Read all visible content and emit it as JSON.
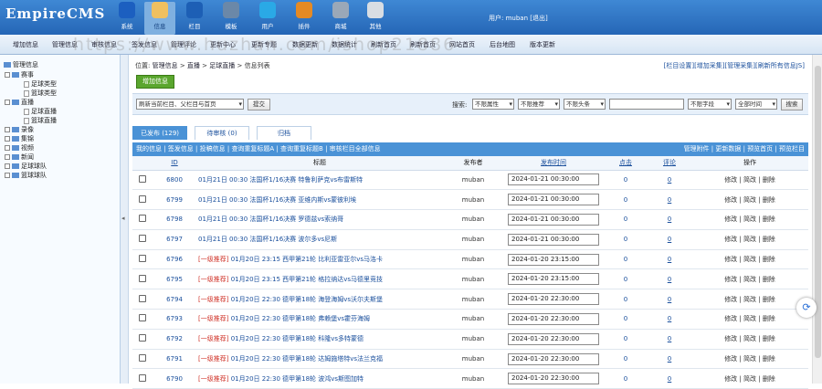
{
  "header": {
    "logo": "EmpireCMS",
    "user_label": "用户:",
    "user_name": "muban",
    "logout": "[退出]"
  },
  "nav": [
    {
      "label": "系统",
      "icon": "globe-icon",
      "color": "#1c5fc0"
    },
    {
      "label": "信息",
      "icon": "document-edit-icon",
      "color": "#f0c060"
    },
    {
      "label": "栏目",
      "icon": "folder-icon",
      "color": "#1d5fb5"
    },
    {
      "label": "模板",
      "icon": "template-icon",
      "color": "#6b88a8"
    },
    {
      "label": "用户",
      "icon": "user-icon",
      "color": "#2aa9e6"
    },
    {
      "label": "插件",
      "icon": "plugin-icon",
      "color": "#e48a25"
    },
    {
      "label": "商城",
      "icon": "shop-icon",
      "color": "#9aa8b8"
    },
    {
      "label": "其他",
      "icon": "gear-icon",
      "color": "#d8dde3"
    }
  ],
  "menu": [
    "增加信息",
    "管理信息",
    "审核信息",
    "签发信息",
    "管理评论",
    "更新中心",
    "更新专题",
    "数据更新",
    "数据统计",
    "刷新首页",
    "刷新首页",
    "网站首页",
    "后台地图",
    "版本更新"
  ],
  "watermark": "https://www.huzhan.com/ishop21886",
  "tree": {
    "title": "管理信息",
    "items": [
      {
        "label": "赛事",
        "level": 0
      },
      {
        "label": "足球类型",
        "level": 1
      },
      {
        "label": "篮球类型",
        "level": 1
      },
      {
        "label": "直播",
        "level": 0
      },
      {
        "label": "足球直播",
        "level": 1
      },
      {
        "label": "篮球直播",
        "level": 1
      },
      {
        "label": "录像",
        "level": 0
      },
      {
        "label": "集锦",
        "level": 0
      },
      {
        "label": "视频",
        "level": 0
      },
      {
        "label": "新闻",
        "level": 0
      },
      {
        "label": "足球球队",
        "level": 0
      },
      {
        "label": "篮球球队",
        "level": 0
      }
    ]
  },
  "location": {
    "prefix": "位置:",
    "crumbs": [
      "管理信息",
      "直播",
      "足球直播"
    ],
    "current": "信息列表"
  },
  "toplinks": [
    "[栏目设置]",
    "[增加采集]",
    "[管理采集]",
    "[刷新所有信息JS]"
  ],
  "add_button": "增加信息",
  "toolbar": {
    "refresh_select": "刷新当前栏目、父栏目与首页",
    "submit": "提交",
    "search_label": "搜索:",
    "attr_select": "不限属性",
    "recommend_select": "不限推荐",
    "headline_select": "不限头条",
    "field_select": "不限字段",
    "time_select": "全部时间",
    "search_button": "搜索"
  },
  "tabs": [
    {
      "label": "已发布 (129)",
      "active": true
    },
    {
      "label": "待审核 (0)",
      "active": false
    },
    {
      "label": "归档",
      "active": false
    }
  ],
  "subbar": {
    "left": [
      "我的信息",
      "签发信息",
      "投稿信息",
      "查询重复标题A",
      "查询重复标题B",
      "审核栏目全部信息"
    ],
    "right": [
      "管理附件",
      "更新数据",
      "预览首页",
      "预览栏目"
    ]
  },
  "columns": [
    "ID",
    "标题",
    "发布者",
    "发布时间",
    "点击",
    "评论",
    "操作"
  ],
  "rows": [
    {
      "id": "6800",
      "rec": "",
      "title": "01月21日 00:30 法国杯1/16决赛 特鲁利萨克vs布雷斯特",
      "author": "muban",
      "time": "2024-01-21 00:30:00",
      "clicks": "0",
      "comments": "0"
    },
    {
      "id": "6799",
      "rec": "",
      "title": "01月21日 00:30 法国杯1/16决赛 亚维内斯vs蒙彼利埃",
      "author": "muban",
      "time": "2024-01-21 00:30:00",
      "clicks": "0",
      "comments": "0"
    },
    {
      "id": "6798",
      "rec": "",
      "title": "01月21日 00:30 法国杯1/16决赛 罗德兹vs索纳哥",
      "author": "muban",
      "time": "2024-01-21 00:30:00",
      "clicks": "0",
      "comments": "0"
    },
    {
      "id": "6797",
      "rec": "",
      "title": "01月21日 00:30 法国杯1/16决赛 波尔多vs尼斯",
      "author": "muban",
      "time": "2024-01-21 00:30:00",
      "clicks": "0",
      "comments": "0"
    },
    {
      "id": "6796",
      "rec": "[一级推荐]",
      "title": "01月20日 23:15 西甲第21轮 比利亚雷亚尔vs马洛卡",
      "author": "muban",
      "time": "2024-01-20 23:15:00",
      "clicks": "0",
      "comments": "0"
    },
    {
      "id": "6795",
      "rec": "[一级推荐]",
      "title": "01月20日 23:15 西甲第21轮 格拉纳达vs马德里竞技",
      "author": "muban",
      "time": "2024-01-20 23:15:00",
      "clicks": "0",
      "comments": "0"
    },
    {
      "id": "6794",
      "rec": "[一级推荐]",
      "title": "01月20日 22:30 德甲第18轮 海登海姆vs沃尔夫斯堡",
      "author": "muban",
      "time": "2024-01-20 22:30:00",
      "clicks": "0",
      "comments": "0"
    },
    {
      "id": "6793",
      "rec": "[一级推荐]",
      "title": "01月20日 22:30 德甲第18轮 弗赖堡vs霍芬海姆",
      "author": "muban",
      "time": "2024-01-20 22:30:00",
      "clicks": "0",
      "comments": "0"
    },
    {
      "id": "6792",
      "rec": "[一级推荐]",
      "title": "01月20日 22:30 德甲第18轮 科隆vs多特蒙德",
      "author": "muban",
      "time": "2024-01-20 22:30:00",
      "clicks": "0",
      "comments": "0"
    },
    {
      "id": "6791",
      "rec": "[一级推荐]",
      "title": "01月20日 22:30 德甲第18轮 达姆施塔特vs法兰克福",
      "author": "muban",
      "time": "2024-01-20 22:30:00",
      "clicks": "0",
      "comments": "0"
    },
    {
      "id": "6790",
      "rec": "[一级推荐]",
      "title": "01月20日 22:30 德甲第18轮 波鸿vs斯图加特",
      "author": "muban",
      "time": "2024-01-20 22:30:00",
      "clicks": "0",
      "comments": "0"
    }
  ],
  "actions": [
    "修改",
    "简改",
    "删除"
  ]
}
